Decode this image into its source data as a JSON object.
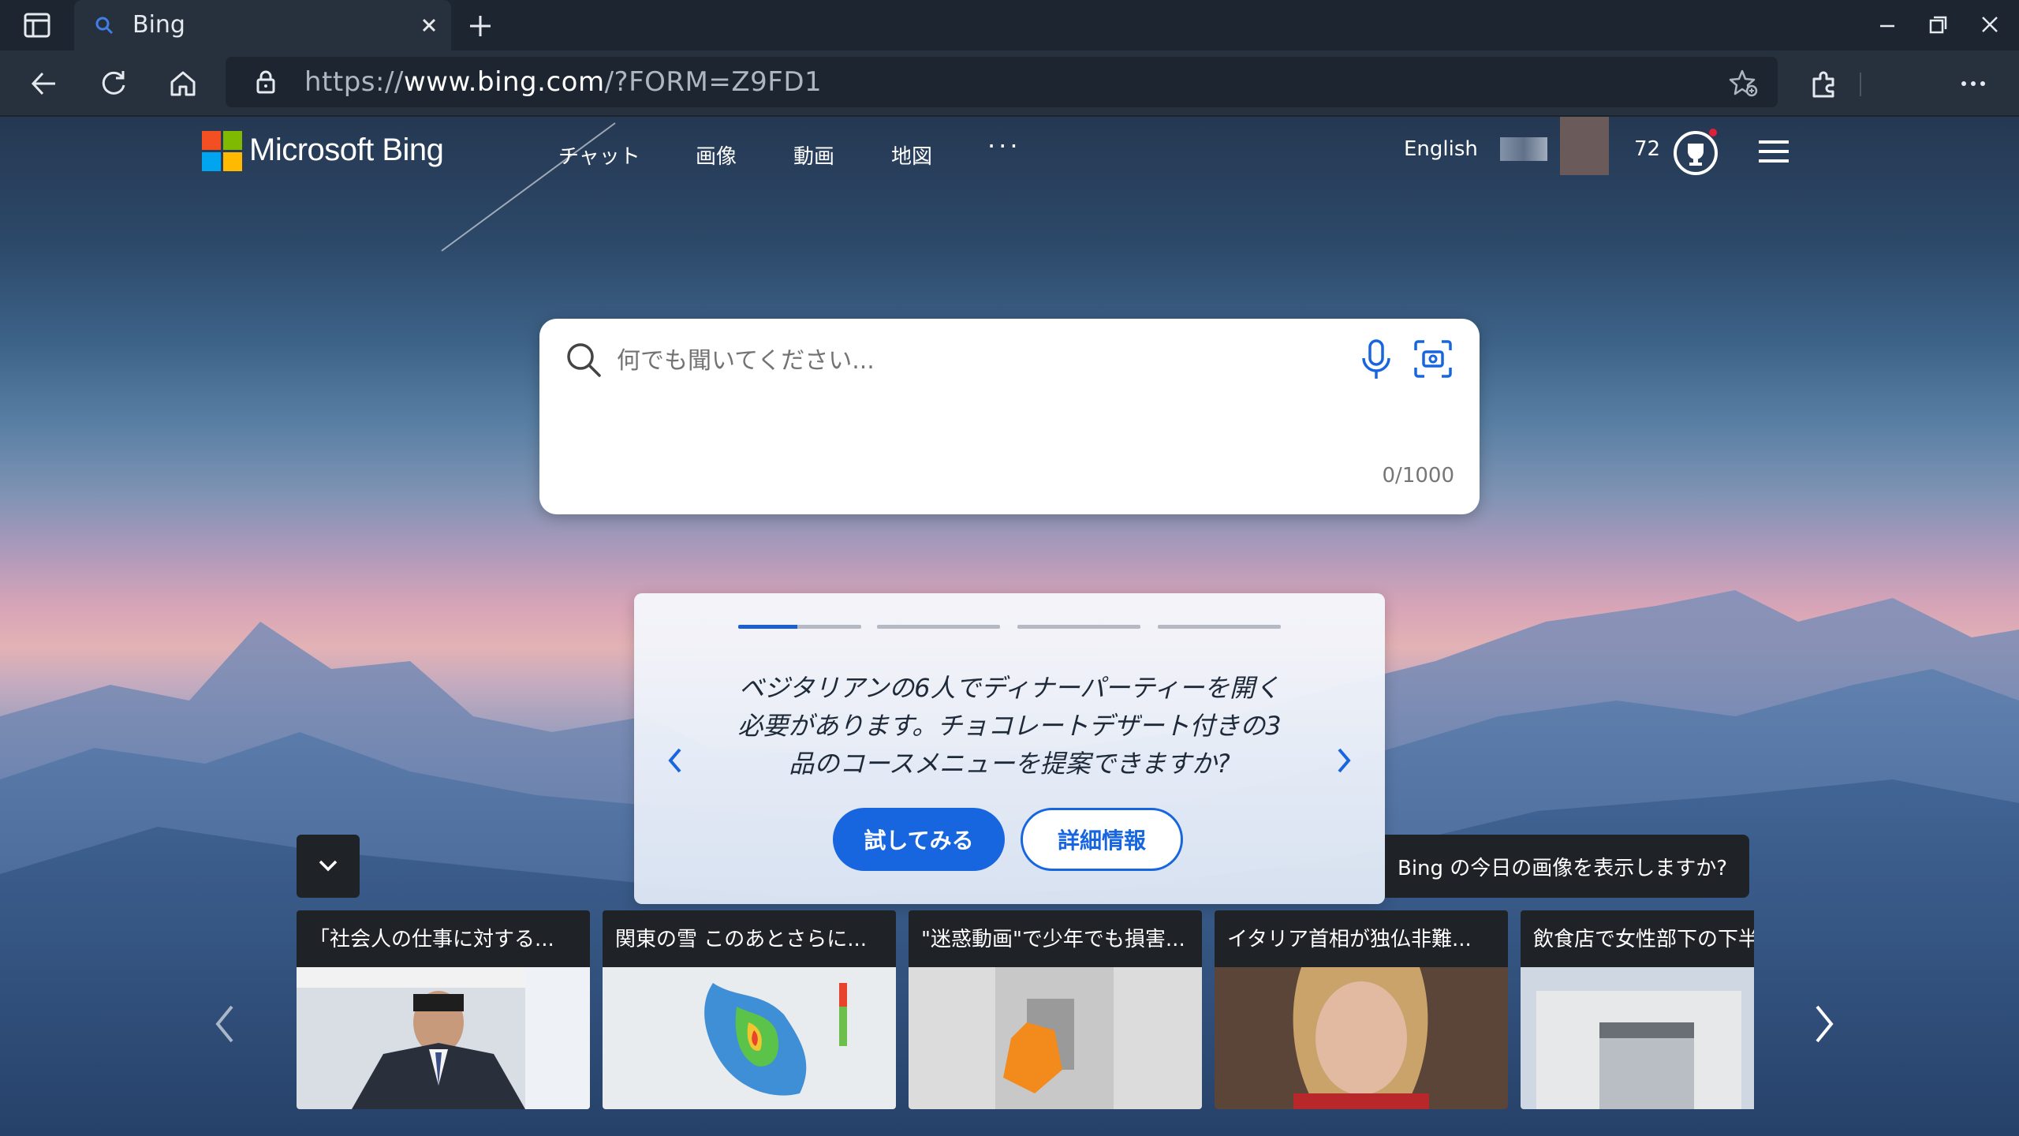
{
  "browser": {
    "tab_title": "Bing",
    "url_prefix": "https://",
    "url_host": "www.bing.com",
    "url_path": "/?FORM=Z9FD1"
  },
  "header": {
    "brand": "Microsoft Bing",
    "nav": [
      "チャット",
      "画像",
      "動画",
      "地図"
    ],
    "more": "···",
    "language": "English",
    "points": "72"
  },
  "search": {
    "placeholder": "何でも聞いてください...",
    "char_count": "0/1000"
  },
  "prompt_card": {
    "text": "ベジタリアンの6人でディナーパーティーを開く必要があります。チョコレートデザート付きの3品のコースメニューを提案できますか?",
    "try_label": "試してみる",
    "info_label": "詳細情報",
    "pages": 4,
    "active_page": 1
  },
  "image_of_day": {
    "prompt": "Bing の今日の画像を表示しますか?"
  },
  "news": [
    {
      "title": "「社会人の仕事に対する..."
    },
    {
      "title": "関東の雪 このあとさらに..."
    },
    {
      "title": "\"迷惑動画\"で少年でも損害..."
    },
    {
      "title": "イタリア首相が独仏非難..."
    },
    {
      "title": "飲食店で女性部下の下半"
    }
  ],
  "colors": {
    "accent": "#1766e0",
    "card_dark": "#1f2328",
    "chrome_dark": "#1c2530",
    "chrome_mid": "#27313d"
  },
  "icons": [
    "sidebar-panel-icon",
    "search-favicon-icon",
    "close-icon",
    "plus-icon",
    "minimize-icon",
    "restore-icon",
    "window-close-icon",
    "back-icon",
    "refresh-icon",
    "home-icon",
    "lock-icon",
    "favorites-icon",
    "extensions-icon",
    "more-icon",
    "search-icon",
    "mic-icon",
    "visual-search-icon",
    "chevron-left-icon",
    "chevron-right-icon",
    "chevron-down-icon",
    "rewards-trophy-icon",
    "hamburger-icon"
  ]
}
